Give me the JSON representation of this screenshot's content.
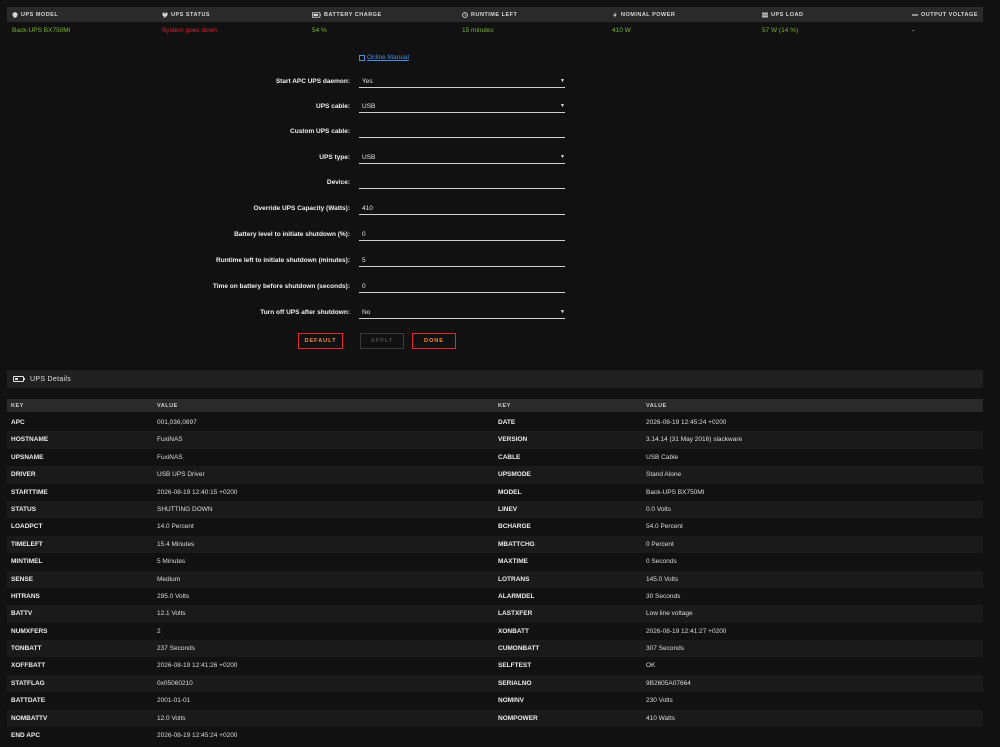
{
  "summary": {
    "headers": [
      {
        "label": "UPS MODEL",
        "icon": "shield-icon"
      },
      {
        "label": "UPS STATUS",
        "icon": "plug-icon"
      },
      {
        "label": "BATTERY CHARGE",
        "icon": "battery-icon"
      },
      {
        "label": "RUNTIME LEFT",
        "icon": "clock-icon"
      },
      {
        "label": "NOMINAL POWER",
        "icon": "bolt-icon"
      },
      {
        "label": "UPS LOAD",
        "icon": "bars-icon"
      },
      {
        "label": "OUTPUT VOLTAGE",
        "icon": "minus-icon"
      }
    ],
    "values": [
      "Back-UPS BX750MI",
      "System goes down",
      "54 %",
      "15 minutes",
      "410 W",
      "57 W (14 %)",
      "-"
    ],
    "colors": {
      "ok": "#7ab431",
      "alert": "#e5202e"
    }
  },
  "form": {
    "manual_link": "Online Manual",
    "fields": [
      {
        "label": "Start APC UPS daemon:",
        "value": "Yes",
        "type": "select"
      },
      {
        "label": "UPS cable:",
        "value": "USB",
        "type": "select"
      },
      {
        "label": "Custom UPS cable:",
        "value": "",
        "type": "input"
      },
      {
        "label": "UPS type:",
        "value": "USB",
        "type": "select"
      },
      {
        "label": "Device:",
        "value": "",
        "type": "input"
      },
      {
        "label": "Override UPS Capacity (Watts):",
        "value": "410",
        "type": "input"
      },
      {
        "label": "Battery level to initiate shutdown (%):",
        "value": "0",
        "type": "input"
      },
      {
        "label": "Runtime left to initiate shutdown (minutes):",
        "value": "5",
        "type": "input"
      },
      {
        "label": "Time on battery before shutdown (seconds):",
        "value": "0",
        "type": "input"
      },
      {
        "label": "Turn off UPS after shutdown:",
        "value": "No",
        "type": "select"
      }
    ],
    "buttons": {
      "default": "DEFAULT",
      "apply": "APPLY",
      "done": "DONE"
    }
  },
  "details": {
    "title": "UPS Details",
    "col_headers": {
      "key": "KEY",
      "value": "VALUE"
    },
    "rows": [
      [
        "APC",
        "001,036,0897",
        "DATE",
        "2026-08-19 12:45:24 +0200"
      ],
      [
        "HOSTNAME",
        "FuxiNAS",
        "VERSION",
        "3.14.14 (31 May 2016) slackware"
      ],
      [
        "UPSNAME",
        "FuxiNAS",
        "CABLE",
        "USB Cable"
      ],
      [
        "DRIVER",
        "USB UPS Driver",
        "UPSMODE",
        "Stand Alone"
      ],
      [
        "STARTTIME",
        "2026-08-19 12:40:15 +0200",
        "MODEL",
        "Back-UPS BX750MI"
      ],
      [
        "STATUS",
        "SHUTTING DOWN",
        "LINEV",
        "0.0 Volts"
      ],
      [
        "LOADPCT",
        "14.0 Percent",
        "BCHARGE",
        "54.0 Percent"
      ],
      [
        "TIMELEFT",
        "15.4 Minutes",
        "MBATTCHG",
        "0 Percent"
      ],
      [
        "MINTIMEL",
        "5 Minutes",
        "MAXTIME",
        "0 Seconds"
      ],
      [
        "SENSE",
        "Medium",
        "LOTRANS",
        "145.0 Volts"
      ],
      [
        "HITRANS",
        "295.0 Volts",
        "ALARMDEL",
        "30 Seconds"
      ],
      [
        "BATTV",
        "12.1 Volts",
        "LASTXFER",
        "Low line voltage"
      ],
      [
        "NUMXFERS",
        "2",
        "XONBATT",
        "2026-08-19 12:41:27 +0200"
      ],
      [
        "TONBATT",
        "237 Seconds",
        "CUMONBATT",
        "307 Seconds"
      ],
      [
        "XOFFBATT",
        "2026-08-19 12:41:26 +0200",
        "SELFTEST",
        "OK"
      ],
      [
        "STATFLAG",
        "0x05060210",
        "SERIALNO",
        "9B2605A07664"
      ],
      [
        "BATTDATE",
        "2001-01-01",
        "NOMINV",
        "230 Volts"
      ],
      [
        "NOMBATTV",
        "12.0 Volts",
        "NOMPOWER",
        "410 Watts"
      ],
      [
        "END APC",
        "2026-08-19 12:45:24 +0200",
        "",
        ""
      ]
    ]
  }
}
